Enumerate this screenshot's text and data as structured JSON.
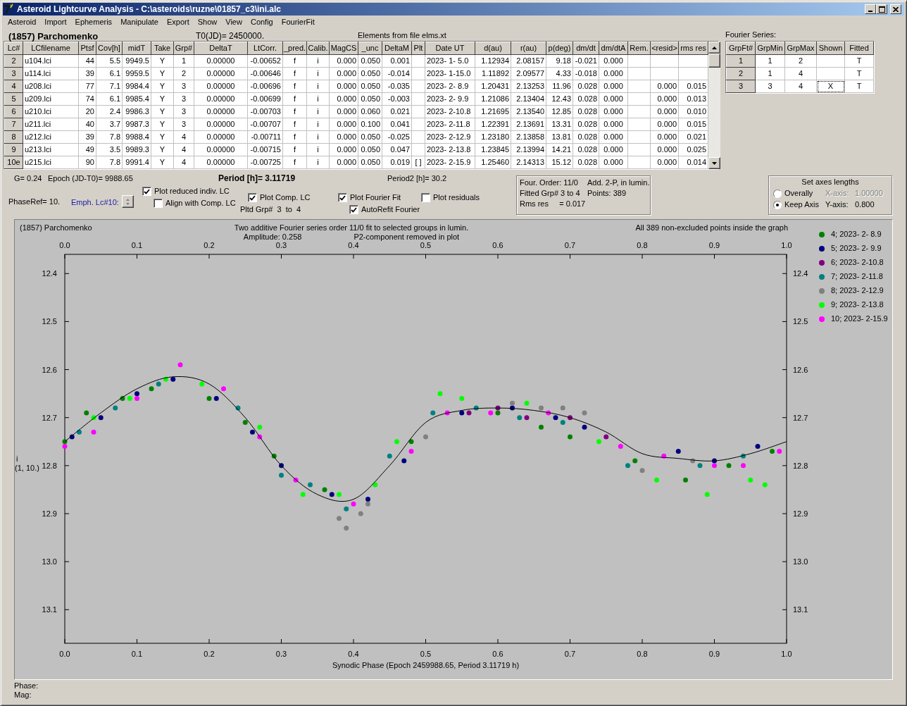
{
  "window": {
    "title": "Asteroid Lightcurve Analysis - C:\\asteroids\\ruzne\\01857_c3\\ini.alc"
  },
  "menu": [
    "Asteroid",
    "Import",
    "Ephemeris",
    "Manipulate",
    "Export",
    "Show",
    "View",
    "Config",
    "FourierFit"
  ],
  "header": {
    "asteroid": "(1857) Parchomenko",
    "t0": "T0(JD)= 2450000.",
    "elements_source": "Elements from file elms.xt",
    "fourier_caption": "Fourier Series:"
  },
  "lc_table": {
    "columns": [
      "Lc#",
      "LCfilename",
      "Ptsf",
      "Cov[h]",
      "midT",
      "Take",
      "Grp#",
      "DeltaT",
      "LtCorr.",
      "_pred.",
      "Calib.",
      "MagCS",
      "_unc",
      "DeltaM",
      "Plt",
      "Date UT",
      "d(au)",
      "r(au)",
      "p(deg)",
      "dm/dt",
      "dm/dtA",
      "Rem.",
      "<resid>",
      "rms res"
    ],
    "rows": [
      [
        "2",
        "u104.lci",
        "44",
        "5.5",
        "9949.5",
        "Y",
        "1",
        "0.00000",
        "-0.00652",
        "f",
        "i",
        "0.000",
        "0.050",
        "0.001",
        null,
        "2023- 1- 5.0",
        "1.12934",
        "2.08157",
        "9.18",
        "-0.021",
        "0.000",
        null,
        null,
        null
      ],
      [
        "3",
        "u114.lci",
        "39",
        "6.1",
        "9959.5",
        "Y",
        "2",
        "0.00000",
        "-0.00646",
        "f",
        "i",
        "0.000",
        "0.050",
        "-0.014",
        null,
        "2023- 1-15.0",
        "1.11892",
        "2.09577",
        "4.33",
        "-0.018",
        "0.000",
        null,
        null,
        null
      ],
      [
        "4",
        "u208.lci",
        "77",
        "7.1",
        "9984.4",
        "Y",
        "3",
        "0.00000",
        "-0.00696",
        "f",
        "i",
        "0.000",
        "0.050",
        "-0.035",
        null,
        "2023- 2- 8.9",
        "1.20431",
        "2.13253",
        "11.96",
        "0.028",
        "0.000",
        null,
        "0.000",
        "0.015"
      ],
      [
        "5",
        "u209.lci",
        "74",
        "6.1",
        "9985.4",
        "Y",
        "3",
        "0.00000",
        "-0.00699",
        "f",
        "i",
        "0.000",
        "0.050",
        "-0.003",
        null,
        "2023- 2- 9.9",
        "1.21086",
        "2.13404",
        "12.43",
        "0.028",
        "0.000",
        null,
        "0.000",
        "0.013"
      ],
      [
        "6",
        "u210.lci",
        "20",
        "2.4",
        "9986.3",
        "Y",
        "3",
        "0.00000",
        "-0.00703",
        "f",
        "i",
        "0.000",
        "0.060",
        "0.021",
        null,
        "2023- 2-10.8",
        "1.21695",
        "2.13540",
        "12.85",
        "0.028",
        "0.000",
        null,
        "0.000",
        "0.010"
      ],
      [
        "7",
        "u211.lci",
        "40",
        "3.7",
        "9987.3",
        "Y",
        "3",
        "0.00000",
        "-0.00707",
        "f",
        "i",
        "0.000",
        "0.100",
        "0.041",
        null,
        "2023- 2-11.8",
        "1.22391",
        "2.13691",
        "13.31",
        "0.028",
        "0.000",
        null,
        "0.000",
        "0.015"
      ],
      [
        "8",
        "u212.lci",
        "39",
        "7.8",
        "9988.4",
        "Y",
        "4",
        "0.00000",
        "-0.00711",
        "f",
        "i",
        "0.000",
        "0.050",
        "-0.025",
        null,
        "2023- 2-12.9",
        "1.23180",
        "2.13858",
        "13.81",
        "0.028",
        "0.000",
        null,
        "0.000",
        "0.021"
      ],
      [
        "9",
        "u213.lci",
        "49",
        "3.5",
        "9989.3",
        "Y",
        "4",
        "0.00000",
        "-0.00715",
        "f",
        "i",
        "0.000",
        "0.050",
        "0.047",
        null,
        "2023- 2-13.8",
        "1.23845",
        "2.13994",
        "14.21",
        "0.028",
        "0.000",
        null,
        "0.000",
        "0.025"
      ],
      [
        "10e",
        "u215.lci",
        "90",
        "7.8",
        "9991.4",
        "Y",
        "4",
        "0.00000",
        "-0.00725",
        "f",
        "i",
        "0.000",
        "0.050",
        "0.019",
        "[ ]",
        "2023- 2-15.9",
        "1.25460",
        "2.14313",
        "15.12",
        "0.028",
        "0.000",
        null,
        "0.000",
        "0.014"
      ]
    ]
  },
  "fourier_table": {
    "columns": [
      "GrpFt#",
      "GrpMin",
      "GrpMax",
      "Shown",
      "Fitted"
    ],
    "rows": [
      [
        "1",
        "1",
        "2",
        null,
        "T"
      ],
      [
        "2",
        "1",
        "4",
        null,
        "T"
      ],
      [
        "3",
        "3",
        "4",
        "X",
        "T"
      ]
    ]
  },
  "params": {
    "g": "G= 0.24",
    "epoch": "Epoch (JD-T0)= 9988.65",
    "period": "Period [h]= 3.11719",
    "period2": "Period2 [h]= 30.2",
    "phase_ref": "PhaseRef= 10.",
    "emph_label": "Emph. Lc#10:",
    "pltd_grp": "Pltd Grp#  3  to  4"
  },
  "options": [
    {
      "label": "Plot reduced indiv. LC",
      "checked": true
    },
    {
      "label": "Align with Comp. LC",
      "checked": false
    },
    {
      "label": "Plot Comp. LC",
      "checked": true
    },
    {
      "label": "Plot Fourier Fit",
      "checked": true
    },
    {
      "label": "AutoRefit Fourier",
      "checked": true
    },
    {
      "label": "Plot residuals",
      "checked": false
    }
  ],
  "fit_info": [
    "Four. Order: 11/0",
    "Add. 2-P, in lumin.",
    "Fitted Grp# 3 to 4",
    "Points: 389",
    "Rms res     = 0.017"
  ],
  "axes_lengths": {
    "title": "Set axes lengths",
    "modes": [
      {
        "label": "Overally",
        "selected": false
      },
      {
        "label": "Keep Axis",
        "selected": true
      }
    ],
    "x_axis": {
      "label": "X-axis:",
      "value": "1.00000",
      "disabled": true
    },
    "y_axis": {
      "label": "Y-axis:",
      "value": "0.800",
      "disabled": false
    }
  },
  "graph": {
    "title": "(1857) Parchomenko",
    "subtitle": "Two additive Fourier series order 11/0 fit to selected groups in lumin.",
    "amplitude": "Amplitude: 0.258",
    "p2_note": "P2-component removed in plot",
    "note": "All 389 non-excluded points inside the graph",
    "y_caption": [
      "i",
      "(1, 10.)"
    ],
    "chart_data": {
      "type": "scatter",
      "xlabel": "Synodic Phase (Epoch 2459988.65, Period 3.11719 h)",
      "xlim": [
        0,
        1
      ],
      "ylim": [
        13.17,
        12.36
      ],
      "xticks": [
        {
          "value": 0,
          "label": "0.0"
        },
        {
          "value": 0.1,
          "label": "0.1"
        },
        {
          "value": 0.2,
          "label": "0.2"
        },
        {
          "value": 0.3,
          "label": "0.3"
        },
        {
          "value": 0.4,
          "label": "0.4"
        },
        {
          "value": 0.5,
          "label": "0.5"
        },
        {
          "value": 0.6,
          "label": "0.6"
        },
        {
          "value": 0.7,
          "label": "0.7"
        },
        {
          "value": 0.8,
          "label": "0.8"
        },
        {
          "value": 0.9,
          "label": "0.9"
        },
        {
          "value": 1,
          "label": "1.0"
        }
      ],
      "yticks": [
        {
          "value": 12.4,
          "label": "12.4"
        },
        {
          "value": 12.5,
          "label": "12.5"
        },
        {
          "value": 12.6,
          "label": "12.6"
        },
        {
          "value": 12.7,
          "label": "12.7"
        },
        {
          "value": 12.8,
          "label": "12.8"
        },
        {
          "value": 12.9,
          "label": "12.9"
        },
        {
          "value": 13,
          "label": "13.0"
        },
        {
          "value": 13.1,
          "label": "13.1"
        }
      ],
      "series": [
        {
          "name": "4; 2023- 2- 8.9",
          "color": "#008000",
          "x": [
            0.0,
            0.03,
            0.08,
            0.12,
            0.2,
            0.25,
            0.29,
            0.36,
            0.48,
            0.6,
            0.66,
            0.7,
            0.79,
            0.86,
            0.92,
            0.98
          ],
          "values": [
            12.75,
            12.69,
            12.66,
            12.64,
            12.66,
            12.71,
            12.78,
            12.85,
            12.75,
            12.69,
            12.72,
            12.74,
            12.79,
            12.83,
            12.8,
            12.77
          ]
        },
        {
          "name": "5; 2023- 2- 9.9",
          "color": "#000080",
          "x": [
            0.01,
            0.05,
            0.1,
            0.15,
            0.21,
            0.26,
            0.3,
            0.37,
            0.42,
            0.47,
            0.55,
            0.62,
            0.68,
            0.72,
            0.85,
            0.9,
            0.96
          ],
          "values": [
            12.74,
            12.7,
            12.65,
            12.62,
            12.66,
            12.73,
            12.8,
            12.86,
            12.87,
            12.79,
            12.69,
            12.68,
            12.7,
            12.72,
            12.77,
            12.79,
            12.76
          ]
        },
        {
          "name": "6; 2023- 2-10.8",
          "color": "#800080",
          "x": [
            0.56,
            0.6,
            0.64,
            0.7,
            0.75
          ],
          "values": [
            12.69,
            12.68,
            12.7,
            12.7,
            12.74
          ]
        },
        {
          "name": "7; 2023- 2-11.8",
          "color": "#008080",
          "x": [
            0.02,
            0.07,
            0.13,
            0.24,
            0.3,
            0.34,
            0.39,
            0.45,
            0.51,
            0.57,
            0.63,
            0.69,
            0.78,
            0.88,
            0.94
          ],
          "values": [
            12.73,
            12.68,
            12.63,
            12.68,
            12.82,
            12.84,
            12.89,
            12.78,
            12.69,
            12.68,
            12.7,
            12.71,
            12.8,
            12.8,
            12.78
          ]
        },
        {
          "name": "8; 2023- 2-12.9",
          "color": "#808080",
          "x": [
            0.38,
            0.39,
            0.41,
            0.42,
            0.5,
            0.62,
            0.66,
            0.69,
            0.72,
            0.8,
            0.87
          ],
          "values": [
            12.91,
            12.93,
            12.9,
            12.88,
            12.74,
            12.67,
            12.68,
            12.68,
            12.69,
            12.81,
            12.79
          ]
        },
        {
          "name": "9; 2023- 2-13.8",
          "color": "#00ff00",
          "x": [
            0.04,
            0.09,
            0.14,
            0.19,
            0.27,
            0.33,
            0.38,
            0.43,
            0.46,
            0.52,
            0.55,
            0.64,
            0.74,
            0.82,
            0.89,
            0.95,
            0.97
          ],
          "values": [
            12.7,
            12.66,
            12.62,
            12.63,
            12.72,
            12.86,
            12.86,
            12.84,
            12.75,
            12.65,
            12.66,
            12.67,
            12.75,
            12.83,
            12.86,
            12.83,
            12.84
          ]
        },
        {
          "name": "10; 2023- 2-15.9",
          "color": "#ff00ff",
          "x": [
            0.0,
            0.04,
            0.1,
            0.16,
            0.22,
            0.27,
            0.32,
            0.4,
            0.48,
            0.53,
            0.59,
            0.67,
            0.77,
            0.83,
            0.9,
            0.94,
            0.99
          ],
          "values": [
            12.76,
            12.73,
            12.66,
            12.59,
            12.64,
            12.74,
            12.83,
            12.88,
            12.77,
            12.69,
            12.69,
            12.69,
            12.76,
            12.78,
            12.8,
            12.8,
            12.77
          ]
        },
        {
          "type": "line",
          "color": "#000000",
          "x": [
            0,
            0.05,
            0.1,
            0.15,
            0.2,
            0.25,
            0.3,
            0.35,
            0.4,
            0.45,
            0.5,
            0.55,
            0.6,
            0.65,
            0.7,
            0.75,
            0.8,
            0.85,
            0.9,
            0.95,
            1.0
          ],
          "values": [
            12.75,
            12.69,
            12.64,
            12.615,
            12.63,
            12.7,
            12.8,
            12.86,
            12.87,
            12.8,
            12.71,
            12.685,
            12.68,
            12.685,
            12.7,
            12.73,
            12.775,
            12.785,
            12.79,
            12.775,
            12.75
          ]
        }
      ]
    }
  },
  "status": [
    "Phase:",
    "Mag:"
  ]
}
